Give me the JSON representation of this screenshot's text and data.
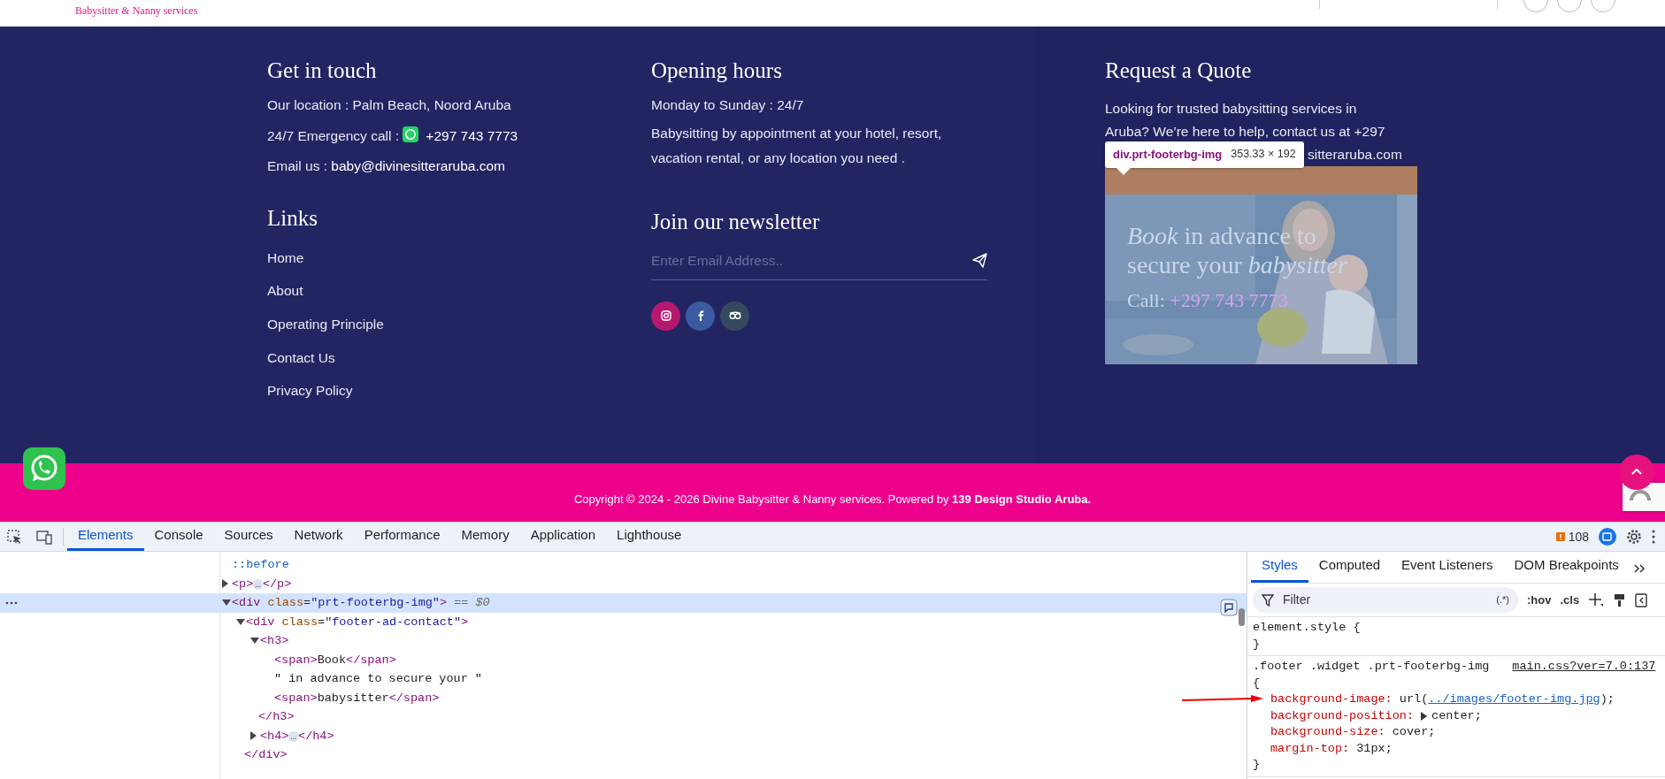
{
  "header": {
    "tagline": "Babysitter & Nanny services"
  },
  "contact": {
    "title": "Get in touch",
    "location": "Our location : Palm Beach, Noord Aruba",
    "emergency_label": "24/7 Emergency call :",
    "phone": "+297 743 7773",
    "email_label": "Email us :",
    "email": "baby@divinesitteraruba.com"
  },
  "links": {
    "title": "Links",
    "items": [
      "Home",
      "About",
      "Operating Principle",
      "Contact Us",
      "Privacy Policy"
    ]
  },
  "hours": {
    "title": "Opening hours",
    "schedule": "Monday to Sunday : 24/7",
    "note": "Babysitting by appointment at your hotel, resort, vacation rental, or any location you need ."
  },
  "newsletter": {
    "title": "Join our newsletter",
    "placeholder": "Enter Email Address..",
    "socials": [
      {
        "kind": "instagram"
      },
      {
        "kind": "facebook"
      },
      {
        "kind": "tripadvisor"
      }
    ]
  },
  "quote": {
    "title": "Request a Quote",
    "lines": [
      "Looking for trusted babysitting services in",
      "Aruba? We’re here to help, contact us at +297",
      "sitteraruba.com"
    ],
    "banner": {
      "headline": [
        "*Book* in advance to",
        "secure your *babysitter*"
      ],
      "call_label": "Call:",
      "phone": "+297 743 7773"
    }
  },
  "inspect_tooltip": {
    "selector": "div.prt-footerbg-img",
    "size": "353.33 × 192"
  },
  "copyright": {
    "text": "Copyright © 2024 - 2026 Divine Babysitter & Nanny services. Powered by",
    "link": "139 Design Studio Aruba."
  },
  "devtools": {
    "tabs": [
      {
        "label": "Elements",
        "selected": true
      },
      {
        "label": "Console",
        "selected": false
      },
      {
        "label": "Sources",
        "selected": false
      },
      {
        "label": "Network",
        "selected": false
      },
      {
        "label": "Performance",
        "selected": false
      },
      {
        "label": "Memory",
        "selected": false
      },
      {
        "label": "Application",
        "selected": false
      },
      {
        "label": "Lighthouse",
        "selected": false
      }
    ],
    "issues": "108",
    "dom": [
      {
        "text": "::before",
        "selected": false
      },
      {
        "text": "<p>…</p>",
        "expanded": false,
        "selected": false
      },
      {
        "text": "<div class=\"prt-footerbg-img\">",
        "marker": "== $0",
        "expanded": true,
        "selected": true,
        "children": [
          {
            "text": "<div class=\"footer-ad-contact\">",
            "expanded": true,
            "selected": false,
            "close": "</div>",
            "children": [
              {
                "text": "<h3>",
                "expanded": true,
                "selected": false,
                "close": "</h3>",
                "children": [
                  {
                    "text": "<span>Book</span>",
                    "selected": false
                  },
                  {
                    "text": "\" in advance to secure your \"",
                    "selected": false
                  },
                  {
                    "text": "<span>babysitter</span>",
                    "selected": false
                  }
                ]
              },
              {
                "text": "<h4>…</h4>",
                "expanded": false,
                "selected": false
              }
            ]
          }
        ]
      }
    ],
    "styles_tabs": [
      {
        "label": "Styles",
        "selected": true
      },
      {
        "label": "Computed",
        "selected": false
      },
      {
        "label": "Event Listeners",
        "selected": false
      },
      {
        "label": "DOM Breakpoints",
        "selected": false
      }
    ],
    "filter_placeholder": "Filter",
    "regex_toggle": "(.*)",
    "hov": ":hov",
    "cls": ".cls",
    "rules": [
      {
        "selector": "element.style {",
        "close": "}"
      },
      {
        "selector": ".footer .widget .prt-footerbg-img",
        "source": "main.css?ver=7.0:137",
        "open": "{",
        "close": "}",
        "declarations": [
          {
            "property": "background-image:",
            "value": "url(",
            "link": "../images/footer-img.jpg",
            "after": ");"
          },
          {
            "property": "background-position:",
            "expandable": true,
            "value": "center;"
          },
          {
            "property": "background-size:",
            "value": "cover;"
          },
          {
            "property": "margin-top:",
            "value": "31px;"
          }
        ]
      }
    ]
  }
}
